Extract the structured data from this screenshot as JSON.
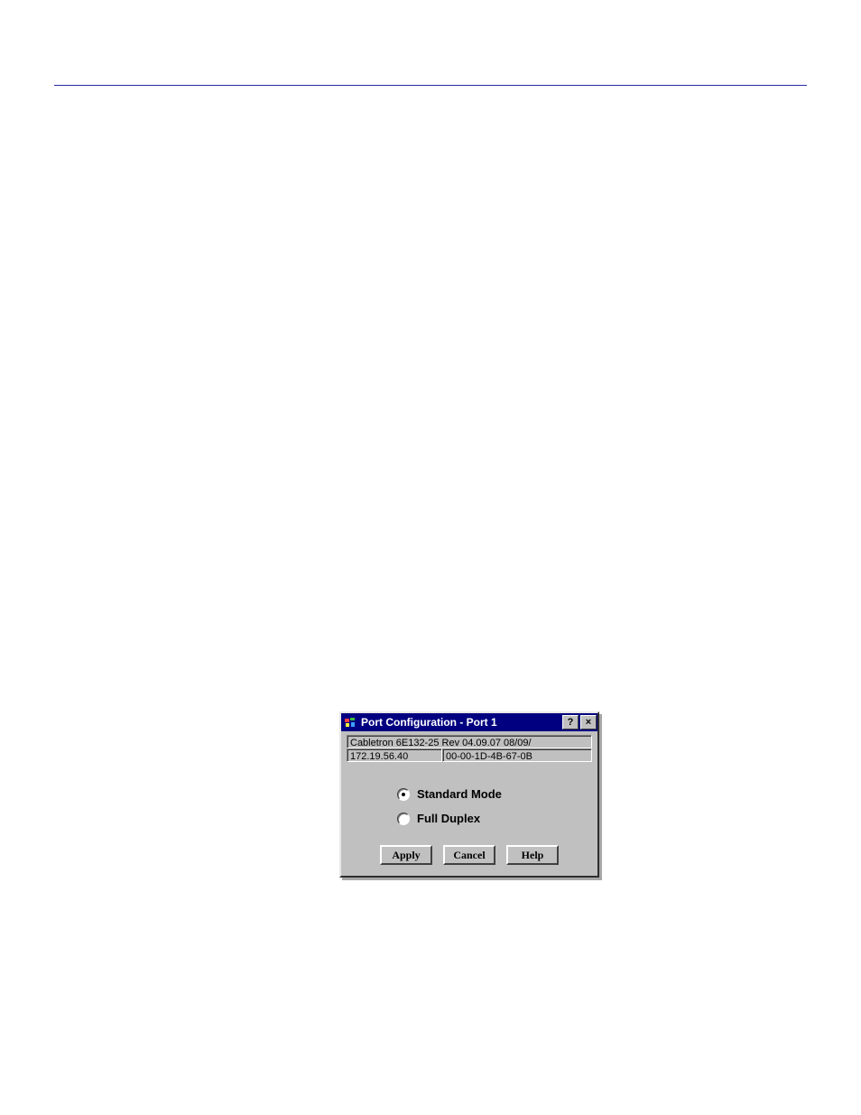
{
  "titlebar": {
    "title": "Port Configuration - Port 1",
    "help_btn": "?",
    "close_btn": "×",
    "sys_icon": "app-icon"
  },
  "info": {
    "device_line": "Cabletron 6E132-25 Rev 04.09.07  08/09/",
    "ip": "172.19.56.40",
    "mac": "00-00-1D-4B-67-0B"
  },
  "radios": {
    "selected_index": 0,
    "options": [
      {
        "label": "Standard Mode"
      },
      {
        "label": "Full Duplex"
      }
    ]
  },
  "buttons": {
    "apply": "Apply",
    "cancel": "Cancel",
    "help": "Help"
  }
}
